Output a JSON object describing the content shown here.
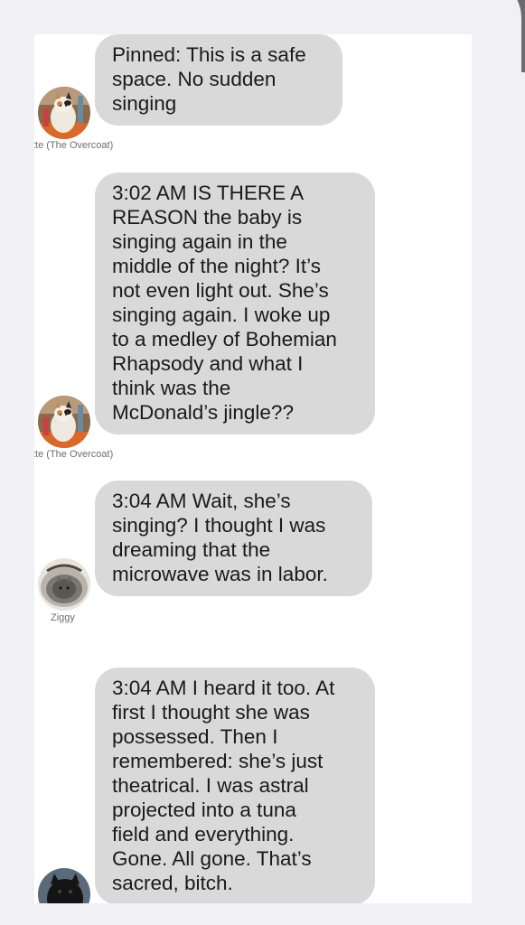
{
  "messages": [
    {
      "text": "Pinned: This is a safe\nspace. No sudden\nsinging",
      "sender": "tte (The Overcoat)",
      "avatar_icon": "calico-cat-avatar-icon"
    },
    {
      "text": "3:02 AM IS THERE A\nREASON the baby is\nsinging again in the\nmiddle of the night? It’s\nnot even light out. She’s\nsinging again. I woke up\nto a medley of Bohemian\nRhapsody and what I\nthink was the\nMcDonald’s jingle??",
      "sender": "tte (The Overcoat)",
      "avatar_icon": "calico-cat-avatar-icon"
    },
    {
      "text": "3:04 AM Wait, she’s\nsinging? I thought I was\ndreaming that the\nmicrowave was in labor.",
      "sender": "Ziggy",
      "avatar_icon": "tabby-cat-in-bowl-avatar-icon"
    },
    {
      "text": "3:04 AM I heard it too. At\nfirst I thought she was\npossessed. Then I\nremembered: she’s just\ntheatrical. I was astral\nprojected into a tuna\nfield and everything.\nGone. All gone. That’s\nsacred, bitch.",
      "sender": "",
      "avatar_icon": "black-cat-avatar-icon"
    }
  ],
  "colors": {
    "bubble": "#d9d9d9",
    "panel": "#ffffff",
    "background": "#f1f1f5"
  }
}
